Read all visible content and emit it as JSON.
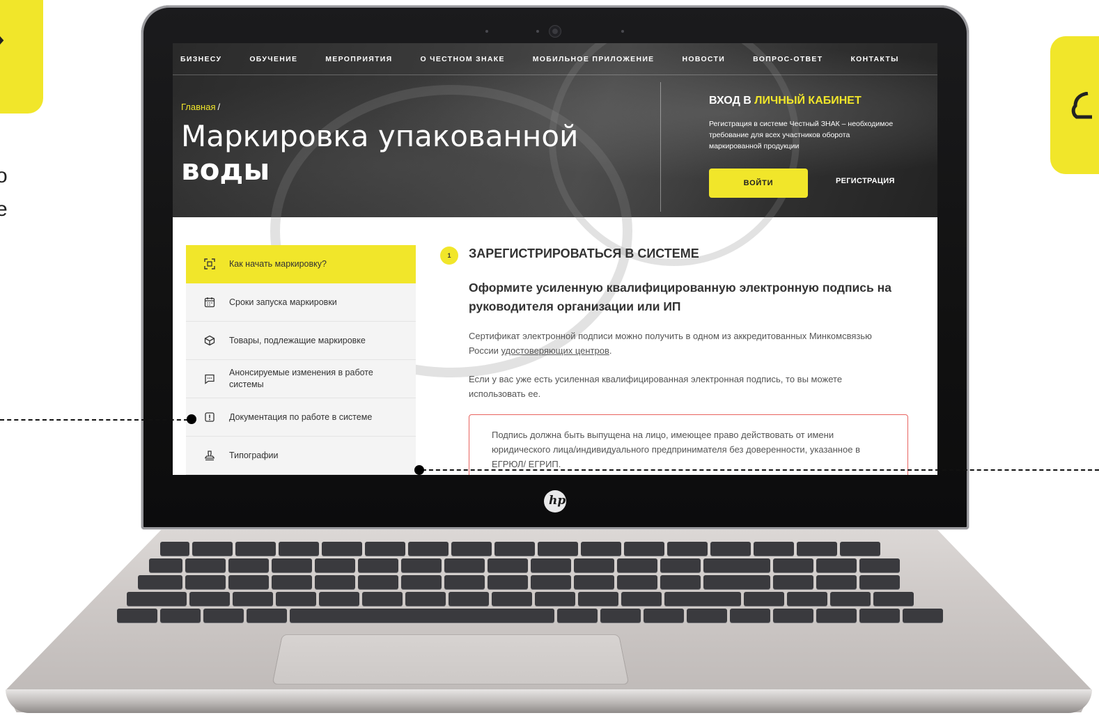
{
  "topnav": {
    "items": [
      "БИЗНЕСУ",
      "ОБУЧЕНИЕ",
      "МЕРОПРИЯТИЯ",
      "О ЧЕСТНОМ ЗНАКЕ",
      "МОБИЛЬНОЕ ПРИЛОЖЕНИЕ",
      "НОВОСТИ",
      "ВОПРОС-ОТВЕТ",
      "КОНТАКТЫ"
    ]
  },
  "breadcrumb": {
    "home": "Главная",
    "separator": "/"
  },
  "page_title": {
    "line1": "Маркировка упакованной",
    "line2": "воды"
  },
  "login": {
    "title_prefix": "ВХОД В",
    "title_accent": "ЛИЧНЫЙ КАБИНЕТ",
    "description": "Регистрация в системе Честный ЗНАК – необходимое требование для всех участников оборота маркированной продукции",
    "enter_label": "ВОЙТИ",
    "register_label": "РЕГИСТРАЦИЯ"
  },
  "sidebar": {
    "items": [
      {
        "label": "Как начать маркировку?",
        "icon": "qr-scan-icon",
        "active": true
      },
      {
        "label": "Сроки запуска маркировки",
        "icon": "calendar-icon",
        "active": false
      },
      {
        "label": "Товары, подлежащие маркировке",
        "icon": "box-icon",
        "active": false
      },
      {
        "label": "Анонсируемые изменения в работе системы",
        "icon": "chat-icon",
        "active": false
      },
      {
        "label": "Документация по работе в системе",
        "icon": "alert-icon",
        "active": false
      },
      {
        "label": "Типографии",
        "icon": "stamp-icon",
        "active": false
      }
    ]
  },
  "content": {
    "step_number": "1",
    "step_title": "ЗАРЕГИСТРИРОВАТЬСЯ В СИСТЕМЕ",
    "subtitle": "Оформите усиленную квалифицированную электронную подпись на руководителя организации или ИП",
    "para1_prefix": "Сертификат электронной подписи можно получить в одном из аккредитованных Минкомсвязью России ",
    "para1_link": "удостоверяющих центров",
    "para1_suffix": ".",
    "para2": "Если у вас уже есть усиленная квалифицированная электронная подпись, то вы можете использовать ее.",
    "warning": "Подпись должна быть выпущена на лицо, имеющее право действовать от имени юридического лица/индивидуального предпринимателя без доверенности, указанное в ЕГРЮЛ/ ЕГРИП."
  },
  "deco": {
    "cut_text_1": "о",
    "cut_text_2": "е"
  },
  "colors": {
    "accent": "#f1e62a",
    "warning_border": "#e8635f",
    "hero_dark": "#2a2a2a"
  }
}
